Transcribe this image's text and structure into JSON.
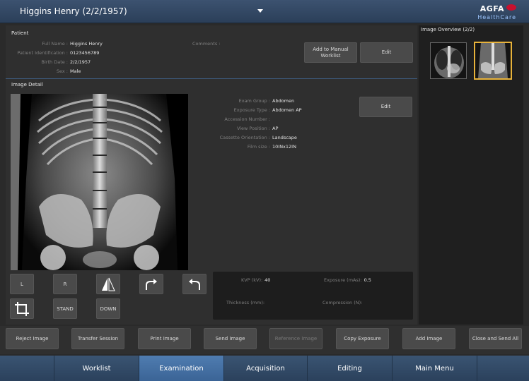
{
  "header": {
    "title": "Higgins Henry (2/2/1957)",
    "logo_text": "AGFA",
    "logo_sub": "HealthCare"
  },
  "patient": {
    "section_label": "Patient",
    "fields": [
      {
        "key": "Full Name :",
        "value": "Higgins Henry"
      },
      {
        "key": "Patient Identification :",
        "value": "0123456789"
      },
      {
        "key": "Birth Date :",
        "value": "2/2/1957"
      },
      {
        "key": "Sex :",
        "value": "Male"
      }
    ],
    "comments_label": "Comments :",
    "add_manual_label": "Add to Manual Worklist",
    "edit_label": "Edit"
  },
  "image_detail": {
    "section_label": "Image Detail",
    "fields": [
      {
        "key": "Exam Group :",
        "value": "Abdomen"
      },
      {
        "key": "Exposure Type :",
        "value": "Abdomen AP"
      },
      {
        "key": "Accession Number :",
        "value": ""
      },
      {
        "key": "View Position :",
        "value": "AP"
      },
      {
        "key": "Cassette Orientation :",
        "value": "Landscape"
      },
      {
        "key": "Film size :",
        "value": "10INx12IN"
      }
    ],
    "edit_label": "Edit",
    "tools": {
      "left_label": "L",
      "right_label": "R",
      "stand_label": "STAND",
      "down_label": "DOWN"
    },
    "params": {
      "kvp_label": "KVP (kV):",
      "kvp_value": "40",
      "exposure_label": "Exposure (mAs):",
      "exposure_value": "0.5",
      "thickness_label": "Thickness (mm):",
      "thickness_value": "",
      "compression_label": "Compression (N):",
      "compression_value": ""
    }
  },
  "overview": {
    "label": "Image Overview (2/2)"
  },
  "actions": {
    "reject": "Reject Image",
    "transfer": "Transfer Session",
    "print": "Print Image",
    "send": "Send Image",
    "reference": "Reference Image",
    "copy": "Copy Exposure",
    "add": "Add Image",
    "close_send": "Close and Send All"
  },
  "nav": {
    "items": [
      "Worklist",
      "Examination",
      "Acquisition",
      "Editing",
      "Main Menu"
    ],
    "active": "Examination"
  },
  "colors": {
    "accent": "#4f7cb0",
    "selected_thumb": "#e7b23a",
    "brand_red": "#c8102e"
  }
}
